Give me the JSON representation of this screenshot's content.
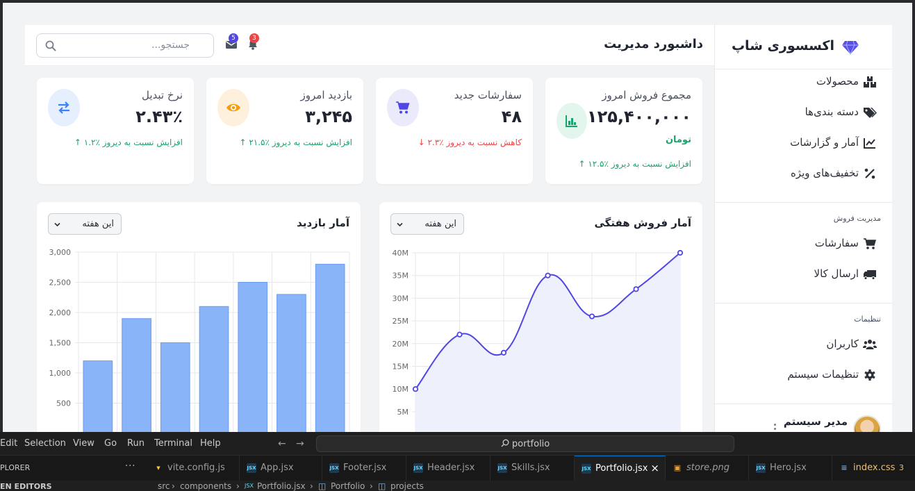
{
  "sidebar": {
    "brand": "اکسسوری شاپ",
    "items": [
      {
        "label": "محصولات",
        "icon": "boxes-icon"
      },
      {
        "label": "دسته بندی‌ها",
        "icon": "tags-icon"
      },
      {
        "label": "آمار و گزارشات",
        "icon": "chart-line-icon"
      },
      {
        "label": "تخفیف‌های ویژه",
        "icon": "percent-icon"
      }
    ],
    "sales_section_title": "مدیریت فروش",
    "sales_items": [
      {
        "label": "سفارشات",
        "icon": "cart-icon"
      },
      {
        "label": "ارسال کالا",
        "icon": "truck-icon"
      }
    ],
    "settings_section_title": "تنظیمات",
    "settings_items": [
      {
        "label": "کاربران",
        "icon": "users-icon"
      },
      {
        "label": "تنظیمات سیستم",
        "icon": "gear-icon"
      }
    ],
    "user_name": "مدیر سیستم"
  },
  "header": {
    "title": "داشبورد مدیریت",
    "search_placeholder": "جستجو...",
    "messages_count": "5",
    "notifications_count": "3"
  },
  "stats": [
    {
      "title": "مجموع فروش امروز",
      "value": "۱۲۵,۴۰۰,۰۰۰",
      "unit": "تومان",
      "change": "۱۲.۵٪ افزایش نسبت به دیروز",
      "direction": "up",
      "icon": "bar-chart-icon",
      "accent": "#1aa36a"
    },
    {
      "title": "سفارشات جدید",
      "value": "۴۸",
      "change": "۲.۳٪ کاهش نسبت به دیروز",
      "direction": "down",
      "icon": "cart-icon",
      "accent": "#4f46e5"
    },
    {
      "title": "بازدید امروز",
      "value": "۳,۲۴۵",
      "change": "۲۱.۵٪ افزایش نسبت به دیروز",
      "direction": "up",
      "icon": "eye-icon",
      "accent": "#f59e0b"
    },
    {
      "title": "نرخ تبدیل",
      "value": "۲.۴۳٪",
      "change": "۱.۲٪ افزایش نسبت به دیروز",
      "direction": "up",
      "icon": "exchange-icon",
      "accent": "#3b82f6"
    }
  ],
  "charts": {
    "sales": {
      "title": "آمار فروش هفتگی",
      "period": "این هفته"
    },
    "visits": {
      "title": "آمار بازدید",
      "period": "این هفته"
    }
  },
  "chart_data": [
    {
      "type": "line",
      "title": "آمار فروش هفتگی",
      "values": [
        10000000,
        22000000,
        18000000,
        35000000,
        26000000,
        32000000,
        40000000
      ],
      "ylim": [
        0,
        40000000
      ],
      "y_ticks": [
        "40M",
        "35M",
        "30M",
        "25M",
        "20M",
        "15M",
        "10M",
        "5M"
      ],
      "color": "#4f46e5",
      "fill": "#eef0fb",
      "grid": true
    },
    {
      "type": "bar",
      "title": "آمار بازدید",
      "values": [
        1200,
        1900,
        1500,
        2100,
        2500,
        2300,
        2800
      ],
      "ylim": [
        0,
        3000
      ],
      "y_ticks": [
        "3,000",
        "2,500",
        "2,000",
        "1,500",
        "1,000",
        "500"
      ],
      "color": "#8ab4f8",
      "border_color": "#6a9cf0",
      "grid": true
    }
  ],
  "vscode": {
    "menu": [
      "Edit",
      "Selection",
      "View",
      "Go",
      "Run",
      "Terminal",
      "Help"
    ],
    "command_center": "portfolio",
    "explorer_label": "PLORER",
    "open_editors_label": "EN EDITORS",
    "tabs": [
      {
        "label": "vite.config.js",
        "icon": "vite-icon"
      },
      {
        "label": "App.jsx",
        "icon": "jsx-icon"
      },
      {
        "label": "Footer.jsx",
        "icon": "jsx-icon"
      },
      {
        "label": "Header.jsx",
        "icon": "jsx-icon"
      },
      {
        "label": "Skills.jsx",
        "icon": "jsx-icon"
      },
      {
        "label": "Portfolio.jsx",
        "icon": "jsx-icon",
        "active": true
      },
      {
        "label": "store.png",
        "icon": "image-icon"
      },
      {
        "label": "Hero.jsx",
        "icon": "jsx-icon"
      },
      {
        "label": "index.css",
        "icon": "css-icon",
        "problems": "3"
      }
    ],
    "breadcrumbs": [
      "src",
      "components",
      "Portfolio.jsx",
      "Portfolio",
      "projects"
    ]
  }
}
